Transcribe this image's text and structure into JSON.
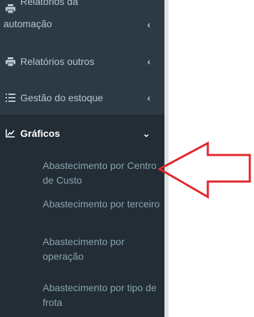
{
  "sidebar": {
    "items": [
      {
        "label_line1": "Relatórios da",
        "label_line2": "automação",
        "icon": "printer-icon",
        "chevron": "‹"
      },
      {
        "label": "Relatórios outros",
        "icon": "printer-icon",
        "chevron": "‹"
      },
      {
        "label": "Gestão do estoque",
        "icon": "list-icon",
        "chevron": "‹"
      },
      {
        "label": "Gráficos",
        "icon": "chart-icon",
        "chevron": "⌄",
        "expanded": true
      }
    ],
    "submenu": [
      {
        "label": "Abastecimento por Centro de Custo"
      },
      {
        "label": "Abastecimento por terceiro"
      },
      {
        "label": "Abastecimento por operação"
      },
      {
        "label": "Abastecimento por tipo de frota"
      }
    ]
  },
  "colors": {
    "sidebar_bg": "#2d3a45",
    "active_bg": "#222d36",
    "text": "#b8c7ce",
    "sub_text": "#8aa4af",
    "arrow": "#e0262b"
  },
  "annotation": {
    "icon": "red-arrow-pointing-left"
  }
}
